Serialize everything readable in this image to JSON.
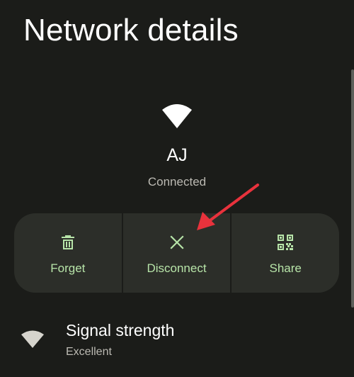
{
  "page": {
    "title": "Network details"
  },
  "network": {
    "name": "AJ",
    "status": "Connected",
    "icon": "wifi-icon"
  },
  "actions": [
    {
      "label": "Forget",
      "icon": "trash-icon"
    },
    {
      "label": "Disconnect",
      "icon": "close-x-icon"
    },
    {
      "label": "Share",
      "icon": "qr-code-icon"
    }
  ],
  "signal": {
    "title": "Signal strength",
    "value": "Excellent",
    "icon": "wifi-icon"
  },
  "colors": {
    "background": "#1b1c19",
    "card": "#2c2e29",
    "accent": "#b7e4a8",
    "annotation_arrow": "#e8323c"
  }
}
